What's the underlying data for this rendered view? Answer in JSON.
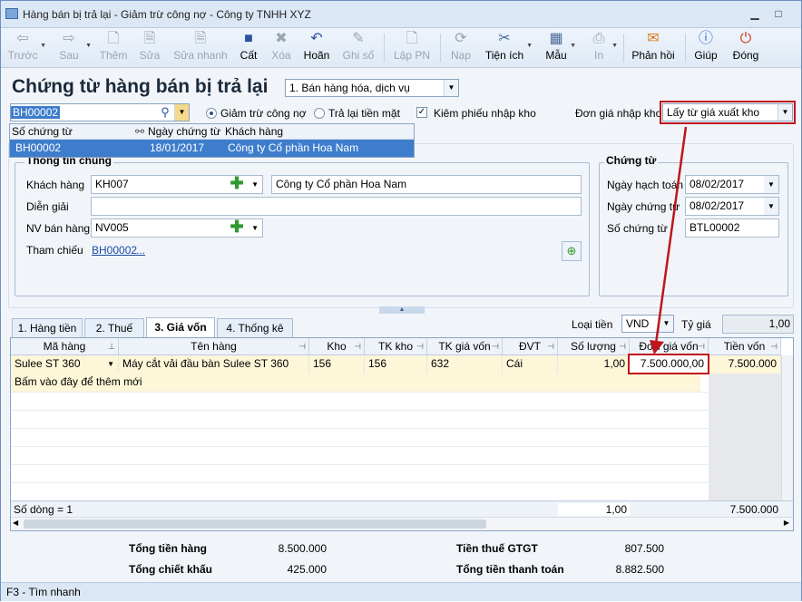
{
  "window": {
    "title": "Hàng bán bị trả lại - Giảm trừ công nợ - Công ty TNHH XYZ"
  },
  "toolbar": [
    {
      "key": "prev",
      "label": "Trước",
      "icon": "arrow-left-icon",
      "enabled": false
    },
    {
      "key": "next",
      "label": "Sau",
      "icon": "arrow-right-icon",
      "enabled": false
    },
    {
      "key": "add",
      "label": "Thêm",
      "icon": "new-doc-icon",
      "enabled": false
    },
    {
      "key": "edit",
      "label": "Sửa",
      "icon": "edit-doc-icon",
      "enabled": false
    },
    {
      "key": "quickedit",
      "label": "Sửa nhanh",
      "icon": "quick-edit-icon",
      "enabled": false
    },
    {
      "key": "save",
      "label": "Cất",
      "icon": "save-icon",
      "enabled": true
    },
    {
      "key": "delete",
      "label": "Xóa",
      "icon": "delete-icon",
      "enabled": false
    },
    {
      "key": "undo",
      "label": "Hoãn",
      "icon": "undo-icon",
      "enabled": true
    },
    {
      "key": "post",
      "label": "Ghi sổ",
      "icon": "pencil-icon",
      "enabled": false
    },
    {
      "key": "pn",
      "label": "Lập PN",
      "icon": "receipt-icon",
      "enabled": false
    },
    {
      "key": "nap",
      "label": "Nạp",
      "icon": "reload-icon",
      "enabled": false
    },
    {
      "key": "util",
      "label": "Tiện ích",
      "icon": "tools-icon",
      "enabled": true
    },
    {
      "key": "tpl",
      "label": "Mẫu",
      "icon": "template-icon",
      "enabled": true
    },
    {
      "key": "print",
      "label": "In",
      "icon": "printer-icon",
      "enabled": false
    },
    {
      "key": "feedback",
      "label": "Phản hồi",
      "icon": "envelope-icon",
      "enabled": true
    },
    {
      "key": "help",
      "label": "Giúp",
      "icon": "help-icon",
      "enabled": true
    },
    {
      "key": "close",
      "label": "Đóng",
      "icon": "power-icon",
      "enabled": true
    }
  ],
  "header": {
    "title": "Chứng từ hàng bán bị trả lại",
    "type_value": "1. Bán hàng hóa, dịch vụ",
    "search_value": "BH00002",
    "radio_reduce": "Giảm trừ công nợ",
    "radio_refund": "Trả lại tiền mặt",
    "checkbox_receipt": "Kiêm phiếu nhập kho",
    "price_label": "Đơn giá nhập kho",
    "price_value": "Lấy từ giá xuất kho"
  },
  "lookup": {
    "columns": [
      "Số chứng từ",
      "Ngày chứng từ",
      "Khách hàng"
    ],
    "row": [
      "BH00002",
      "18/01/2017",
      "Công ty Cổ phần Hoa Nam"
    ]
  },
  "general": {
    "title": "Thông tin chung",
    "customer_label": "Khách hàng",
    "customer_code": "KH007",
    "customer_name": "Công ty Cổ phần Hoa Nam",
    "desc_label": "Diễn giải",
    "desc_value": "",
    "staff_label": "NV bán hàng",
    "staff_value": "NV005",
    "ref_label": "Tham chiếu",
    "ref_link": "BH00002",
    "ref_more": "..."
  },
  "voucher": {
    "title": "Chứng từ",
    "post_date_label": "Ngày hạch toán",
    "post_date": "08/02/2017",
    "doc_date_label": "Ngày chứng từ",
    "doc_date": "08/02/2017",
    "doc_no_label": "Số chứng từ",
    "doc_no": "BTL00002"
  },
  "tabs": [
    "1. Hàng tiền",
    "2. Thuế",
    "3. Giá vốn",
    "4. Thống kê"
  ],
  "currency": {
    "label": "Loại tiền",
    "value": "VND",
    "rate_label": "Tỷ giá",
    "rate": "1,00"
  },
  "grid": {
    "columns": [
      "Mã hàng",
      "Tên hàng",
      "Kho",
      "TK kho",
      "TK giá vốn",
      "ĐVT",
      "Số lượng",
      "Đơn giá vốn",
      "Tiền vốn"
    ],
    "row": [
      "Sulee ST 360",
      "Máy cắt vải đầu bàn Sulee ST 360",
      "156",
      "156",
      "632",
      "Cái",
      "1,00",
      "7.500.000,00",
      "7.500.000"
    ],
    "add_hint": "Bấm vào đây để thêm mới",
    "footer_count": "Số dòng = 1",
    "footer_qty": "1,00",
    "footer_total": "7.500.000"
  },
  "totals": {
    "goods_label": "Tổng tiền hàng",
    "goods": "8.500.000",
    "discount_label": "Tổng chiết khấu",
    "discount": "425.000",
    "vat_label": "Tiền thuế GTGT",
    "vat": "807.500",
    "pay_label": "Tổng tiền thanh toán",
    "pay": "8.882.500"
  },
  "status": {
    "text": "F3 - Tìm nhanh"
  },
  "colors": {
    "highlight": "#c0141c",
    "selection": "#3e7dcc"
  }
}
